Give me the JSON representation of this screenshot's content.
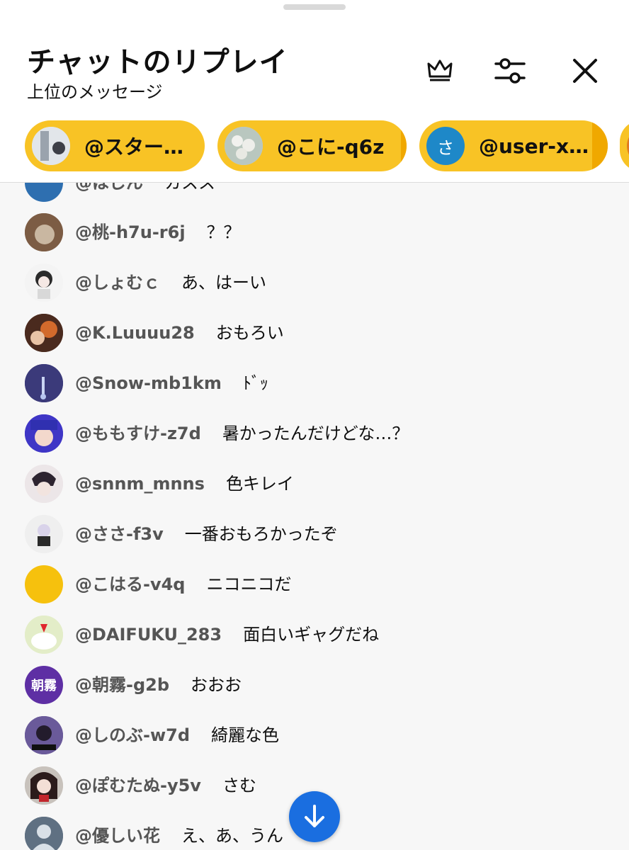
{
  "header": {
    "title": "チャットのリプレイ",
    "subtitle": "上位のメッセージ",
    "icons": [
      "crown-icon",
      "filter-sliders-icon",
      "close-icon"
    ]
  },
  "chips": [
    {
      "label": "@スター…",
      "avatar": "photo"
    },
    {
      "label": "@こに-q6z",
      "avatar": "photo"
    },
    {
      "label": "@user-xj...",
      "avatar_letter": "さ"
    }
  ],
  "messages": [
    {
      "author": "@ほじん",
      "text": "カスス"
    },
    {
      "author": "@桃-h7u-r6j",
      "text": "？？"
    },
    {
      "author": "@しょむｃ",
      "text": "あ、はーい"
    },
    {
      "author": "@K.Luuuu28",
      "text": "おもろい"
    },
    {
      "author": "@Snow-mb1km",
      "text": "ﾄﾞｯ"
    },
    {
      "author": "@ももすけ-z7d",
      "text": "暑かったんだけどな…？"
    },
    {
      "author": "@snnm_mnns",
      "text": "色キレイ"
    },
    {
      "author": "@ささ-f3v",
      "text": "一番おもろかったぞ"
    },
    {
      "author": "@こはる-v4q",
      "text": "ニコニコだ"
    },
    {
      "author": "@DAIFUKU_283",
      "text": "面白いギャグだね"
    },
    {
      "author": "@朝霧-g2b",
      "text": "おおお",
      "avatar_text": "朝霧"
    },
    {
      "author": "@しのぶ-w7d",
      "text": "綺麗な色"
    },
    {
      "author": "@ぽむたぬ-y5v",
      "text": "さむ"
    },
    {
      "author": "@優しい花",
      "text": "え、あ、うん"
    }
  ],
  "colors": {
    "chip": "#f8c325",
    "fab": "#1a6ee0",
    "background": "#f7f7f7"
  }
}
